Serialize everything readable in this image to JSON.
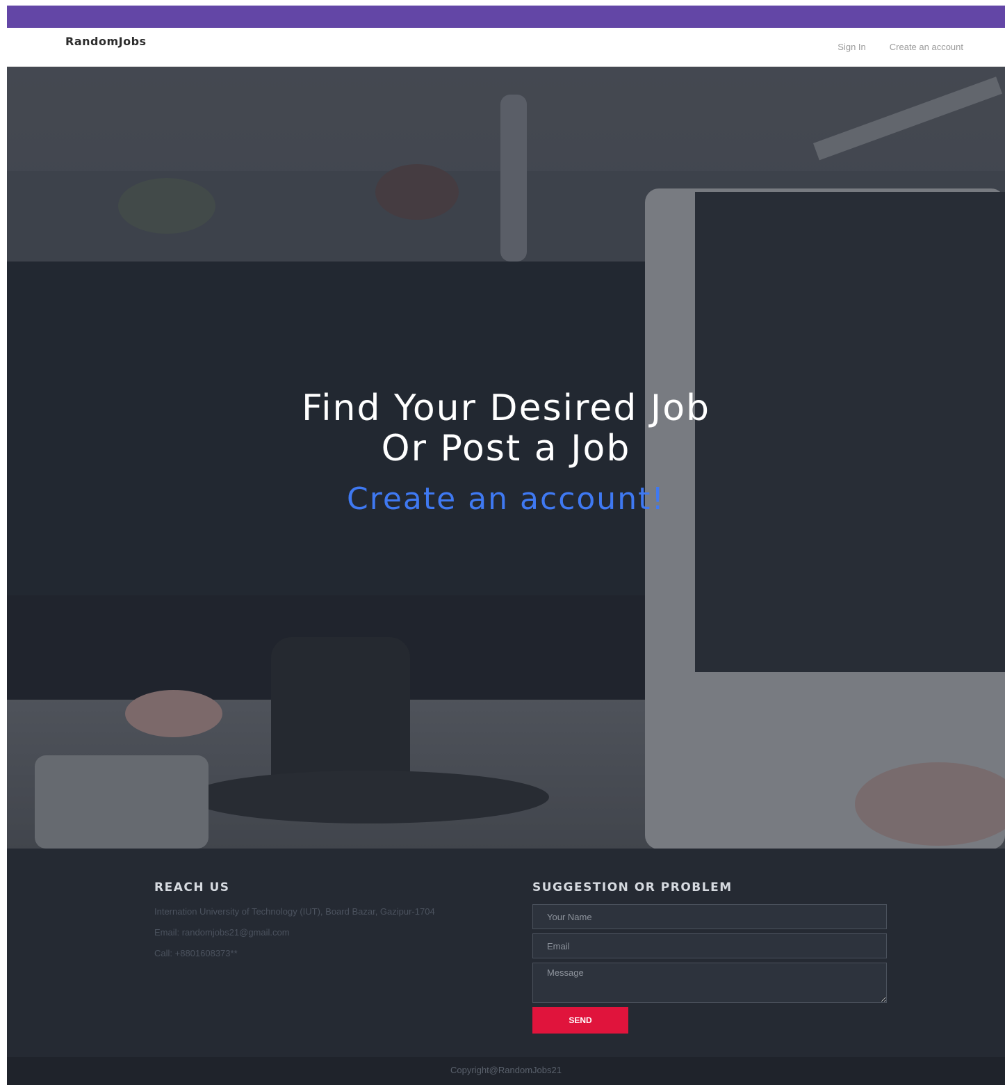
{
  "navbar": {
    "brand": "RandomJobs",
    "links": [
      {
        "label": "Sign In"
      },
      {
        "label": "Create an account"
      }
    ]
  },
  "hero": {
    "title_line1": "Find Your Desired Job",
    "title_line2": "Or Post a Job",
    "cta_label": "Create an account!"
  },
  "footer": {
    "reach_us": {
      "heading": "REACH US",
      "address": "Internation University of Technology (IUT), Board Bazar, Gazipur-1704",
      "email": "Email: randomjobs21@gmail.com",
      "call": "Call: +8801608373**"
    },
    "suggestion_form": {
      "heading": "SUGGESTION OR PROBLEM",
      "name_placeholder": "Your Name",
      "email_placeholder": "Email",
      "message_placeholder": "Message",
      "send_label": "SEND"
    },
    "copyright": "Copyright@RandomJobs21"
  },
  "colors": {
    "top_strip": "#6346a6",
    "cta": "#3f79f2",
    "send_button": "#e0143c",
    "footer_bg": "#252a33"
  }
}
